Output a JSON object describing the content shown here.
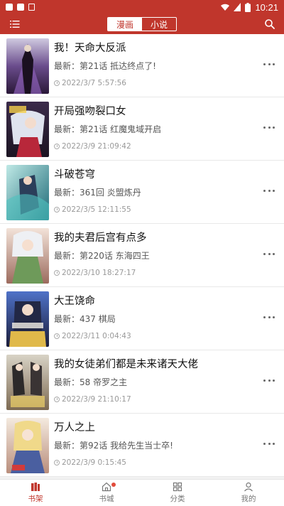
{
  "status_bar": {
    "time": "10:21"
  },
  "header": {
    "tabs": [
      {
        "label": "漫画",
        "active": true
      },
      {
        "label": "小说",
        "active": false
      }
    ]
  },
  "list": [
    {
      "title": "我！天命大反派",
      "latest": "最新：第21话 抵达终点了!",
      "time": "2022/3/7 5:57:56"
    },
    {
      "title": "开局强吻裂口女",
      "latest": "最新：第21话 红魔鬼域开启",
      "time": "2022/3/9 21:09:42"
    },
    {
      "title": "斗破苍穹",
      "latest": "最新：361回 炎盟炼丹",
      "time": "2022/3/5 12:11:55"
    },
    {
      "title": "我的夫君后宫有点多",
      "latest": "最新：第220话 东海四王",
      "time": "2022/3/10 18:27:17"
    },
    {
      "title": "大王饶命",
      "latest": "最新：437 棋局",
      "time": "2022/3/11 0:04:43"
    },
    {
      "title": "我的女徒弟们都是未来诸天大佬",
      "latest": "最新：58 帝罗之主",
      "time": "2022/3/9 21:10:17"
    },
    {
      "title": "万人之上",
      "latest": "最新：第92话 我给先生当士卒!",
      "time": "2022/3/9 0:15:45"
    }
  ],
  "bottom_nav": [
    {
      "label": "书架",
      "icon": "bookshelf-icon",
      "active": true
    },
    {
      "label": "书城",
      "icon": "home-icon",
      "active": false,
      "badge_dot": true
    },
    {
      "label": "分类",
      "icon": "grid-icon",
      "active": false
    },
    {
      "label": "我的",
      "icon": "user-icon",
      "active": false
    }
  ],
  "colors": {
    "accent": "#c0362c",
    "badge": "#e14b3b"
  }
}
